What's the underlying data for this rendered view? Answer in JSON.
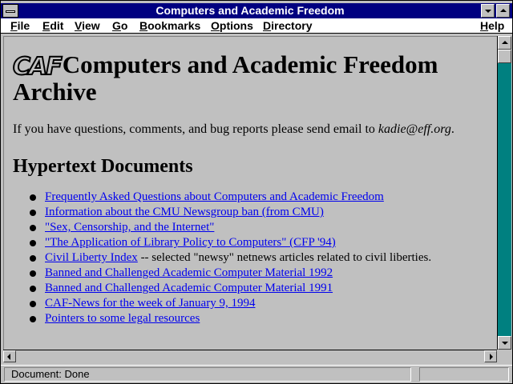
{
  "window": {
    "title": "Computers and Academic Freedom"
  },
  "menu": {
    "items": [
      {
        "label": "File",
        "underline": "F",
        "rest": "ile"
      },
      {
        "label": "Edit",
        "underline": "E",
        "rest": "dit"
      },
      {
        "label": "View",
        "underline": "V",
        "rest": "iew"
      },
      {
        "label": "Go",
        "underline": "G",
        "rest": "o"
      },
      {
        "label": "Bookmarks",
        "underline": "B",
        "rest": "ookmarks"
      },
      {
        "label": "Options",
        "underline": "O",
        "rest": "ptions"
      },
      {
        "label": "Directory",
        "underline": "D",
        "rest": "irectory"
      },
      {
        "label": "Help",
        "underline": "H",
        "rest": "elp"
      }
    ]
  },
  "page": {
    "logo_text": "CAF",
    "heading": "Computers and Academic Freedom Archive",
    "intro_text": "If you have questions, comments, and bug reports please send email to ",
    "intro_email": "kadie@eff.org",
    "intro_end": ".",
    "section_heading": "Hypertext Documents",
    "documents": [
      {
        "link": "Frequently Asked Questions about Computers and Academic Freedom",
        "suffix": ""
      },
      {
        "link": "Information about the CMU Newsgroup ban (from CMU)",
        "suffix": ""
      },
      {
        "link": "\"Sex, Censorship, and the Internet\"",
        "suffix": ""
      },
      {
        "link": "\"The Application of Library Policy to Computers\" (CFP '94)",
        "suffix": ""
      },
      {
        "link": "Civil Liberty Index",
        "suffix": " -- selected \"newsy\" netnews articles related to civil liberties."
      },
      {
        "link": "Banned and Challenged Academic Computer Material 1992",
        "suffix": ""
      },
      {
        "link": "Banned and Challenged Academic Computer Material 1991",
        "suffix": ""
      },
      {
        "link": "CAF-News for the week of January 9, 1994",
        "suffix": ""
      },
      {
        "link": "Pointers to some legal resources",
        "suffix": ""
      }
    ]
  },
  "status": {
    "text": "Document: Done"
  },
  "colors": {
    "titlebar": "#000080",
    "link": "#0000ee",
    "scrollbar_track": "#008080",
    "chrome": "#c0c0c0"
  }
}
